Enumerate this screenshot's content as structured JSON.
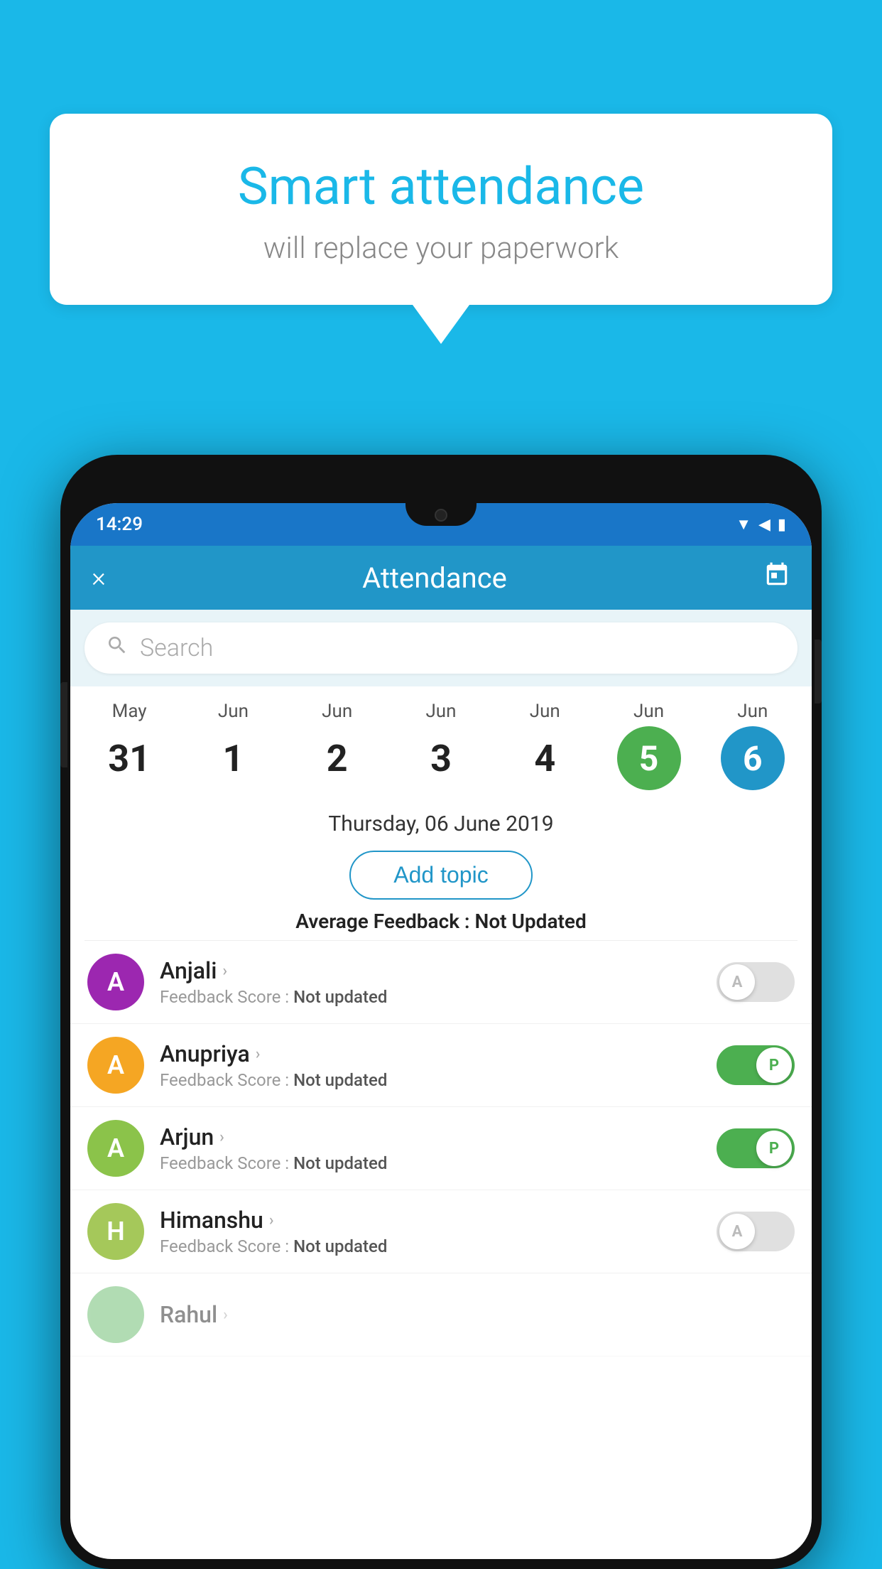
{
  "background_color": "#1ab8e8",
  "speech_bubble": {
    "title": "Smart attendance",
    "subtitle": "will replace your paperwork"
  },
  "status_bar": {
    "time": "14:29",
    "icons": [
      "wifi",
      "signal",
      "battery"
    ]
  },
  "app_bar": {
    "title": "Attendance",
    "close_label": "×",
    "calendar_label": "📅"
  },
  "search": {
    "placeholder": "Search"
  },
  "date_row": [
    {
      "month": "May",
      "day": "31",
      "selected": false
    },
    {
      "month": "Jun",
      "day": "1",
      "selected": false
    },
    {
      "month": "Jun",
      "day": "2",
      "selected": false
    },
    {
      "month": "Jun",
      "day": "3",
      "selected": false
    },
    {
      "month": "Jun",
      "day": "4",
      "selected": false
    },
    {
      "month": "Jun",
      "day": "5",
      "selected": "green"
    },
    {
      "month": "Jun",
      "day": "6",
      "selected": "blue"
    }
  ],
  "selected_date": "Thursday, 06 June 2019",
  "add_topic_label": "Add topic",
  "avg_feedback_label": "Average Feedback :",
  "avg_feedback_value": "Not Updated",
  "students": [
    {
      "name": "Anjali",
      "avatar_letter": "A",
      "avatar_color": "#9c27b0",
      "feedback_label": "Feedback Score :",
      "feedback_value": "Not updated",
      "attendance": "A",
      "attendance_status": "off"
    },
    {
      "name": "Anupriya",
      "avatar_letter": "A",
      "avatar_color": "#f5a623",
      "feedback_label": "Feedback Score :",
      "feedback_value": "Not updated",
      "attendance": "P",
      "attendance_status": "on"
    },
    {
      "name": "Arjun",
      "avatar_letter": "A",
      "avatar_color": "#8bc34a",
      "feedback_label": "Feedback Score :",
      "feedback_value": "Not updated",
      "attendance": "P",
      "attendance_status": "on"
    },
    {
      "name": "Himanshu",
      "avatar_letter": "H",
      "avatar_color": "#a5c85a",
      "feedback_label": "Feedback Score :",
      "feedback_value": "Not updated",
      "attendance": "A",
      "attendance_status": "off"
    }
  ]
}
